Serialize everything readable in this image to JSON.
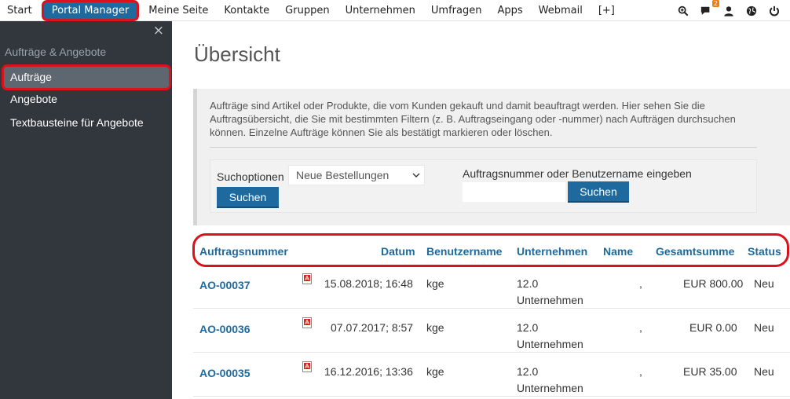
{
  "topnav": {
    "items": [
      {
        "label": "Start"
      },
      {
        "label": "Portal Manager"
      },
      {
        "label": "Meine Seite"
      },
      {
        "label": "Kontakte"
      },
      {
        "label": "Gruppen"
      },
      {
        "label": "Unternehmen"
      },
      {
        "label": "Umfragen"
      },
      {
        "label": "Apps"
      },
      {
        "label": "Webmail"
      },
      {
        "label": "[+]"
      }
    ],
    "active_index": 1,
    "icons": [
      "search-zoom-icon",
      "chat-icon",
      "user-icon",
      "globe-icon",
      "power-icon"
    ],
    "chat_badge": "2"
  },
  "sidebar": {
    "close": "×",
    "heading": "Aufträge & Angebote",
    "items": [
      {
        "label": "Aufträge"
      },
      {
        "label": "Angebote"
      },
      {
        "label": "Textbausteine für Angebote"
      }
    ]
  },
  "main": {
    "title": "Übersicht",
    "info": "Aufträge sind Artikel oder Produkte, die vom Kunden gekauft und damit beauftragt werden. Hier sehen Sie die Auftragsübersicht, die Sie mit bestimmten Filtern (z. B. Auftragseingang oder -nummer) nach Aufträgen durchsuchen können. Einzelne Aufträge können Sie als bestätigt markieren oder löschen.",
    "search": {
      "options_label": "Suchoptionen",
      "option_selected": "Neue Bestellungen",
      "button1": "Suchen",
      "number_label": "Auftragsnummer oder Benutzername eingeben",
      "number_value": "",
      "button2": "Suchen"
    },
    "table": {
      "headers": {
        "number": "Auftragsnummer",
        "date": "Datum",
        "user": "Benutzername",
        "company": "Unternehmen",
        "name": "Name",
        "total": "Gesamtsumme",
        "status": "Status"
      },
      "rows": [
        {
          "number": "AO-00037",
          "date": "15.08.2018; 16:48",
          "user": "kge",
          "company1": "12.0",
          "company2": "Unternehmen",
          "name": ",",
          "total": "EUR 800.00",
          "status": "Neu"
        },
        {
          "number": "AO-00036",
          "date": "07.07.2017; 8:57",
          "user": "kge",
          "company1": "12.0",
          "company2": "Unternehmen",
          "name": ",",
          "total": "EUR 0.00",
          "status": "Neu"
        },
        {
          "number": "AO-00035",
          "date": "16.12.2016; 13:36",
          "user": "kge",
          "company1": "12.0",
          "company2": "Unternehmen",
          "name": ",",
          "total": "EUR 35.00",
          "status": "Neu"
        }
      ]
    }
  },
  "colors": {
    "brand_blue": "#1e6a9e",
    "sidebar_bg": "#32373d",
    "highlight_red": "#d9121b",
    "badge_orange": "#f07d10"
  }
}
